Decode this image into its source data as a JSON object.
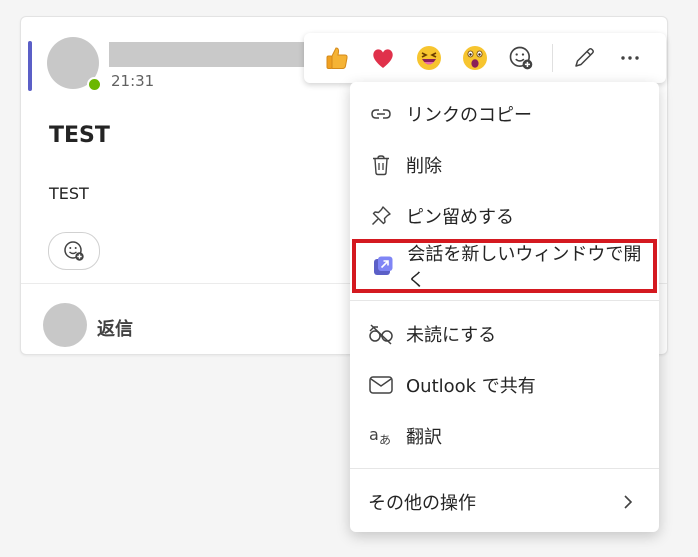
{
  "message": {
    "time": "21:31",
    "subject": "TEST",
    "body": "TEST",
    "reply_label": "返信"
  },
  "reactions": [
    {
      "name": "like",
      "glyph": "👍"
    },
    {
      "name": "heart",
      "glyph": "❤️"
    },
    {
      "name": "laugh",
      "glyph": "😆"
    },
    {
      "name": "surprised",
      "glyph": "😮"
    }
  ],
  "menu": {
    "items": [
      {
        "label": "リンクのコピー",
        "icon": "link-icon"
      },
      {
        "label": "削除",
        "icon": "trash-icon"
      },
      {
        "label": "ピン留めする",
        "icon": "pin-icon"
      },
      {
        "label": "会話を新しいウィンドウで開く",
        "icon": "popout-icon"
      },
      {
        "label": "未読にする",
        "icon": "unread-icon"
      },
      {
        "label": "Outlook で共有",
        "icon": "mail-icon"
      },
      {
        "label": "翻訳",
        "icon": "translate-icon"
      }
    ],
    "more_actions": "その他の操作"
  },
  "colors": {
    "accent": "#5b5fc7",
    "presence": "#6bb700",
    "highlight_border": "#d41920"
  }
}
